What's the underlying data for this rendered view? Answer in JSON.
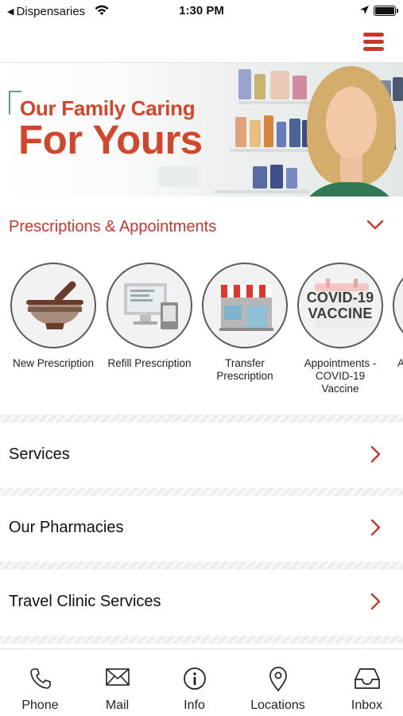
{
  "status_bar": {
    "back_label": "Dispensaries",
    "time": "1:30 PM"
  },
  "banner": {
    "line1": "Our Family Caring",
    "line2": "For Yours"
  },
  "section": {
    "title": "Prescriptions & Appointments"
  },
  "carousel": {
    "items": [
      {
        "label": "New Prescription",
        "icon": "mortar-pestle-icon"
      },
      {
        "label": "Refill Prescription",
        "icon": "computer-monitor-icon"
      },
      {
        "label": "Transfer Prescription",
        "icon": "storefront-icon"
      },
      {
        "label": "Appointments - COVID-19 Vaccine",
        "icon": "covid-vaccine-icon",
        "icon_text": "COVID-19 VACCINE"
      },
      {
        "label": "A",
        "icon": "partial-item-icon"
      }
    ]
  },
  "list": {
    "items": [
      {
        "label": "Services"
      },
      {
        "label": "Our Pharmacies"
      },
      {
        "label": "Travel Clinic Services"
      }
    ]
  },
  "tab_bar": {
    "tabs": [
      {
        "label": "Phone",
        "icon": "phone-icon"
      },
      {
        "label": "Mail",
        "icon": "mail-icon"
      },
      {
        "label": "Info",
        "icon": "info-icon"
      },
      {
        "label": "Locations",
        "icon": "location-pin-icon"
      },
      {
        "label": "Inbox",
        "icon": "inbox-icon"
      }
    ]
  },
  "colors": {
    "accent": "#c8362c",
    "banner_text": "#d2472b",
    "banner_bracket": "#5aa485"
  }
}
